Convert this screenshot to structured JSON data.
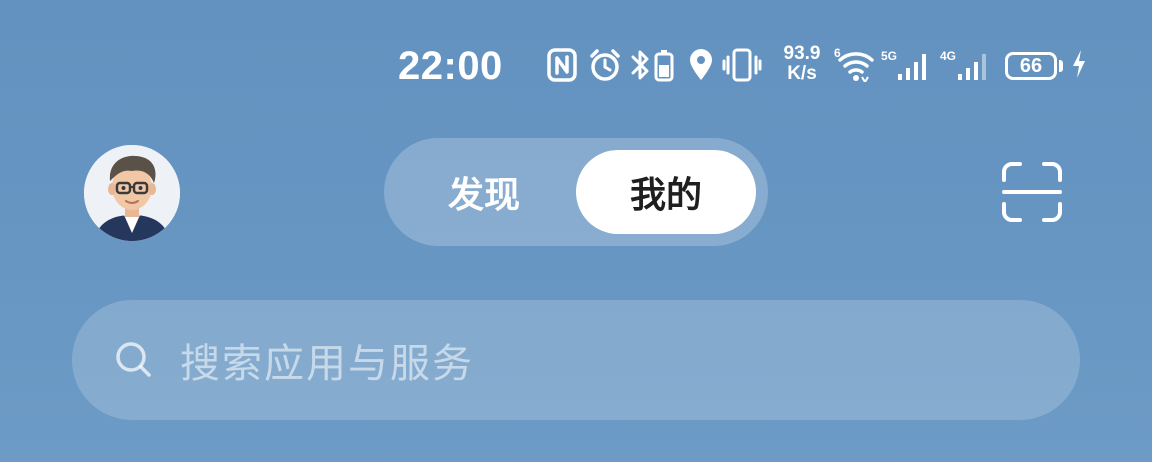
{
  "status_bar": {
    "time": "22:00",
    "net_speed_value": "93.9",
    "net_speed_unit": "K/s",
    "wifi_label": "6",
    "sim1_label": "5G",
    "sim2_label": "4G",
    "battery_level": "66",
    "icons": [
      "nfc-icon",
      "alarm-icon",
      "bluetooth-battery-icon",
      "location-icon",
      "vibrate-icon",
      "wifi-icon",
      "signal-5g-icon",
      "signal-4g-icon",
      "battery-icon",
      "charging-icon"
    ]
  },
  "header": {
    "avatar_icon": "user-avatar",
    "tabs": [
      {
        "label": "发现",
        "active": false
      },
      {
        "label": "我的",
        "active": true
      }
    ],
    "scan_icon": "scan-icon"
  },
  "search": {
    "placeholder": "搜索应用与服务",
    "icon": "search-icon"
  },
  "colors": {
    "background": "#6695c2",
    "active_tab_bg": "#ffffff",
    "active_tab_text": "#1f1f1f"
  }
}
